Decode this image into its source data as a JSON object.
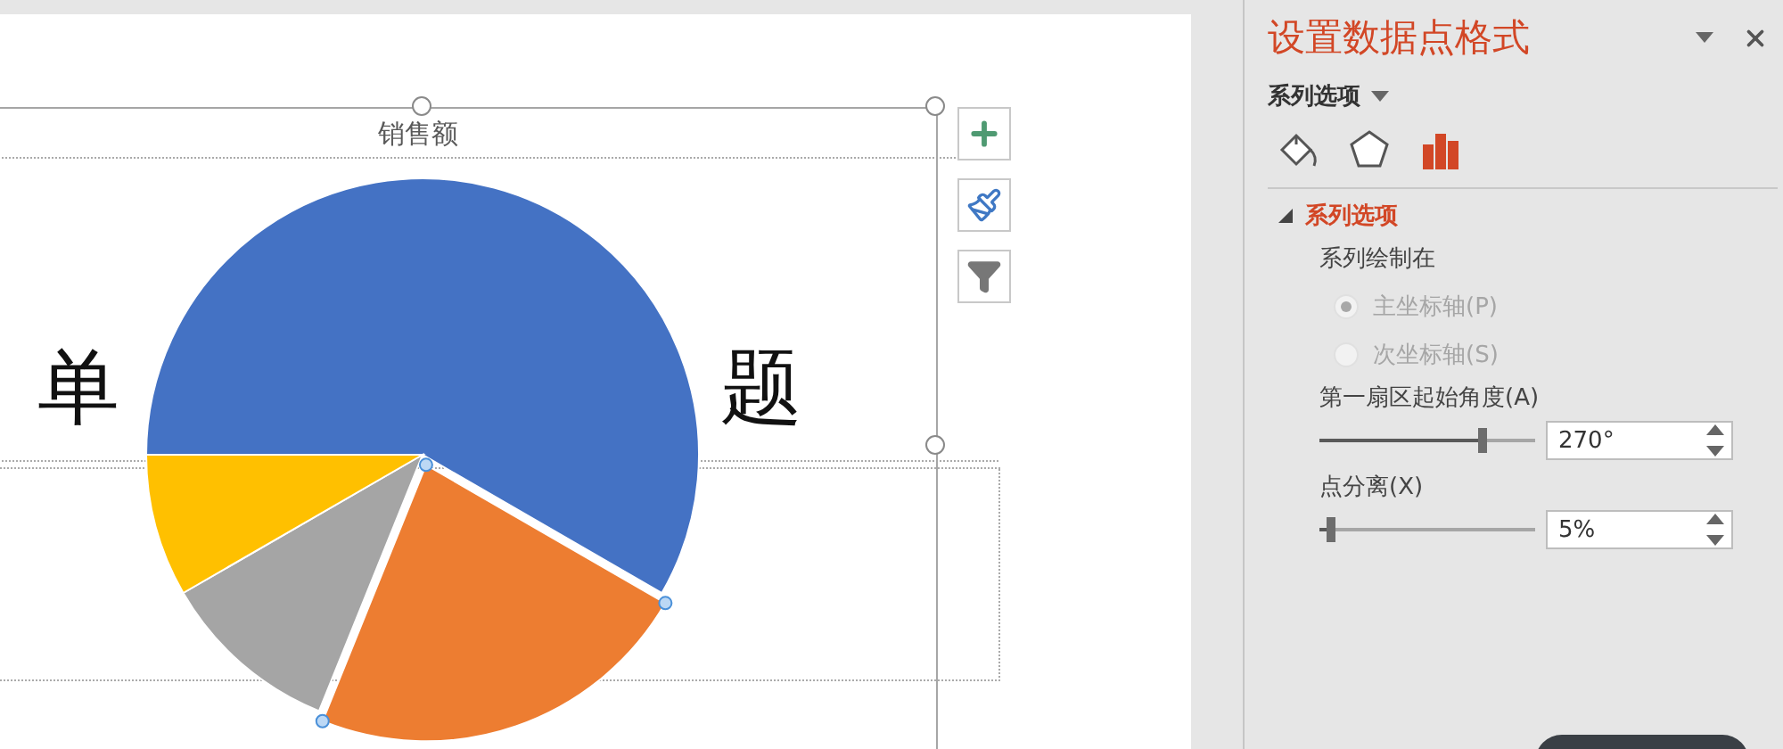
{
  "slide": {
    "title_fragments": [
      "单",
      "题"
    ],
    "chart": {
      "title": "销售额",
      "slices": [
        {
          "color": "#4472c4"
        },
        {
          "color": "#ed7d31"
        },
        {
          "color": "#a5a5a5"
        },
        {
          "color": "#ffc000"
        }
      ]
    },
    "chart_tools": [
      {
        "kind": "add"
      },
      {
        "kind": "style"
      },
      {
        "kind": "filter"
      }
    ]
  },
  "panel": {
    "title": "设置数据点格式",
    "options_menu": "系列选项",
    "tabs": [
      {
        "kind": "fill",
        "selected": false
      },
      {
        "kind": "effects",
        "selected": false
      },
      {
        "kind": "series",
        "selected": true
      }
    ],
    "section": {
      "title": "系列选项",
      "expanded": true,
      "plot_on_label": "系列绘制在",
      "axes": [
        {
          "label": "主坐标轴(P)",
          "selected": true,
          "disabled": true
        },
        {
          "label": "次坐标轴(S)",
          "selected": false,
          "disabled": true
        }
      ],
      "sliders": [
        {
          "label": "第一扇区起始角度(A)",
          "level": 0.75,
          "value": "270°"
        },
        {
          "label": "点分离(X)",
          "level": 0.05,
          "value": "5%"
        }
      ]
    }
  }
}
